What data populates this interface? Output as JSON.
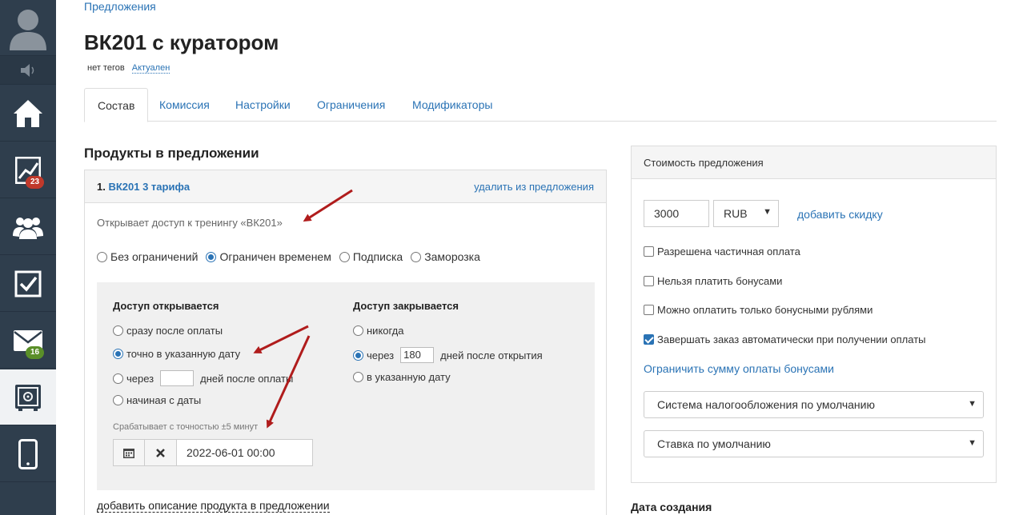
{
  "sidebar": {
    "stats_badge": "23",
    "mail_badge": "16"
  },
  "breadcrumb": "Предложения",
  "title": "ВК201 с куратором",
  "tags": {
    "none": "нет тегов",
    "status": "Актуален"
  },
  "tabs": [
    "Состав",
    "Комиссия",
    "Настройки",
    "Ограничения",
    "Модификаторы"
  ],
  "section_title": "Продукты в предложении",
  "product": {
    "number": "1.",
    "name": "ВК201 3 тарифа",
    "remove": "удалить из предложения",
    "opens_access": "Открывает доступ к тренингу «ВК201»",
    "access_types": [
      "Без ограничений",
      "Ограничен временем",
      "Подписка",
      "Заморозка"
    ],
    "access_type_selected": "Ограничен временем",
    "open_title": "Доступ открывается",
    "open_options": {
      "after_payment": "сразу после оплаты",
      "exact_date": "точно в указанную дату",
      "through": "через",
      "days_after_payment": "дней после оплаты",
      "from_date": "начиная с даты"
    },
    "open_selected": "точно в указанную дату",
    "close_title": "Доступ закрывается",
    "close_options": {
      "never": "никогда",
      "through": "через",
      "days": "180",
      "days_after_open": "дней после открытия",
      "at_date": "в указанную дату"
    },
    "close_selected": "через",
    "hint": "Срабатывает с точностью ±5 минут",
    "date_value": "2022-06-01 00:00",
    "add_description": "добавить описание продукта в предложении"
  },
  "price": {
    "title": "Стоимость предложения",
    "amount": "3000",
    "currency": "RUB",
    "add_discount": "добавить скидку",
    "checkboxes": [
      {
        "label": "Разрешена частичная оплата",
        "checked": false
      },
      {
        "label": "Нельзя платить бонусами",
        "checked": false
      },
      {
        "label": "Можно оплатить только бонусными рублями",
        "checked": false
      },
      {
        "label": "Завершать заказ автоматически при получении оплаты",
        "checked": true
      }
    ],
    "limit_bonus": "Ограничить сумму оплаты бонусами",
    "tax_system": "Система налогообложения по умолчанию",
    "tax_rate": "Ставка по умолчанию"
  },
  "created_title": "Дата создания",
  "colors": {
    "accent": "#2a73b5",
    "sidebar": "#2f3e4d",
    "arrow": "#b01c1c"
  }
}
